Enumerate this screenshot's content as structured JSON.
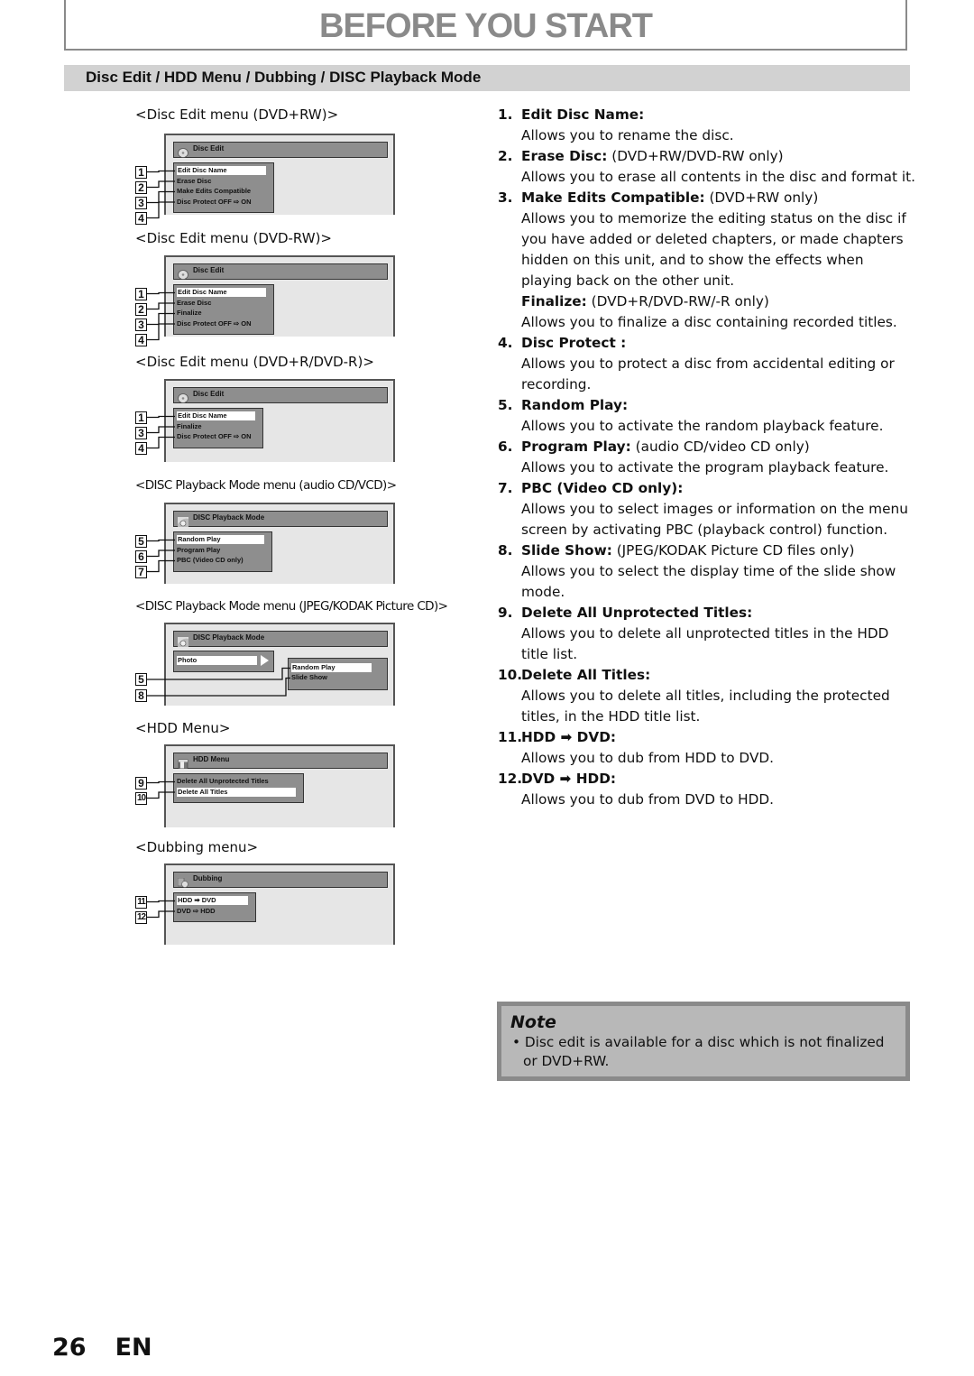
{
  "header": {
    "title": "BEFORE YOU START"
  },
  "section": {
    "title": "Disc Edit / HDD Menu / Dubbing / DISC Playback Mode"
  },
  "menus": [
    {
      "caption": "<Disc Edit menu (DVD+RW)>",
      "screen_title": "Disc Edit",
      "icon": "disc-icon",
      "items": [
        "Edit Disc Name",
        "Erase Disc",
        "Make Edits Compatible",
        "Disc Protect OFF ⇨ ON"
      ],
      "numbers": [
        "1",
        "2",
        "3",
        "4"
      ],
      "selected_index": 0
    },
    {
      "caption": "<Disc Edit menu (DVD-RW)>",
      "screen_title": "Disc Edit",
      "icon": "disc-icon",
      "items": [
        "Edit Disc Name",
        "Erase Disc",
        "Finalize",
        "Disc Protect OFF ⇨ ON"
      ],
      "numbers": [
        "1",
        "2",
        "3",
        "4"
      ],
      "selected_index": 0
    },
    {
      "caption": "<Disc Edit menu (DVD+R/DVD-R)>",
      "screen_title": "Disc Edit",
      "icon": "disc-icon",
      "items": [
        "Edit Disc Name",
        "Finalize",
        "Disc Protect OFF ⇨ ON"
      ],
      "numbers": [
        "1",
        "3",
        "4"
      ],
      "selected_index": 0
    },
    {
      "caption": "<DISC Playback Mode menu (audio CD/VCD)>",
      "screen_title": "DISC Playback Mode",
      "icon": "playback-mode-icon",
      "items": [
        "Random Play",
        "Program Play",
        "PBC (Video CD only)"
      ],
      "numbers": [
        "5",
        "6",
        "7"
      ],
      "selected_index": 0
    },
    {
      "caption": "<DISC Playback Mode menu (JPEG/KODAK Picture CD)>",
      "screen_title": "DISC Playback Mode",
      "icon": "playback-mode-icon",
      "parent_item": "Photo",
      "items": [
        "Random Play",
        "Slide Show"
      ],
      "numbers": [
        "5",
        "8"
      ],
      "selected_index": 0
    },
    {
      "caption": "<HDD Menu>",
      "screen_title": "HDD Menu",
      "icon": "hdd-icon",
      "items": [
        "Delete All Unprotected Titles",
        "Delete All Titles"
      ],
      "numbers": [
        "9",
        "10"
      ],
      "selected_index": 1
    },
    {
      "caption": "<Dubbing menu>",
      "screen_title": "Dubbing",
      "icon": "dubbing-icon",
      "items": [
        "HDD ➡ DVD",
        "DVD ⇨ HDD"
      ],
      "numbers": [
        "11",
        "12"
      ],
      "selected_index": 0
    }
  ],
  "descriptions": [
    {
      "num": "1.",
      "label": "Edit Disc Name:",
      "qualifier": "",
      "text": "Allows you to rename the disc."
    },
    {
      "num": "2.",
      "label": "Erase Disc:",
      "qualifier": " (DVD+RW/DVD-RW only)",
      "text": "Allows you to erase all contents in the disc and format it."
    },
    {
      "num": "3.",
      "label": "Make Edits Compatible:",
      "qualifier": " (DVD+RW only)",
      "text": "Allows you to memorize the editing status on the disc if you have added or deleted chapters, or made chapters hidden on this unit, and to show the effects when playing back on the other unit."
    },
    {
      "num": "",
      "label": "Finalize:",
      "qualifier": " (DVD+R/DVD-RW/-R only)",
      "text": "Allows you to finalize a disc containing recorded titles."
    },
    {
      "num": "4.",
      "label": "Disc Protect :",
      "qualifier": "",
      "text": "Allows you to protect a disc from accidental editing or recording."
    },
    {
      "num": "5.",
      "label": "Random Play:",
      "qualifier": "",
      "text": "Allows you to activate the random playback feature."
    },
    {
      "num": "6.",
      "label": "Program Play:",
      "qualifier": " (audio CD/video CD only)",
      "text": "Allows you to activate the program playback feature."
    },
    {
      "num": "7.",
      "label": "PBC (Video CD only):",
      "qualifier": "",
      "text": "Allows you to select images or information on the menu screen by activating PBC (playback control) function."
    },
    {
      "num": "8.",
      "label": "Slide Show:",
      "qualifier": " (JPEG/KODAK Picture CD files only)",
      "text": "Allows you to select the display time of the slide show mode."
    },
    {
      "num": "9.",
      "label": "Delete All Unprotected Titles:",
      "qualifier": "",
      "text": "Allows you to delete all unprotected titles in the HDD title list."
    },
    {
      "num": "10.",
      "label": "Delete All Titles:",
      "qualifier": "",
      "text": "Allows you to delete all titles, including the protected titles, in the HDD title list."
    },
    {
      "num": "11.",
      "label": "HDD ➡ DVD:",
      "qualifier": "",
      "text": "Allows you to dub from HDD to DVD."
    },
    {
      "num": "12.",
      "label": "DVD ➡ HDD:",
      "qualifier": "",
      "text": "Allows you to dub from DVD to HDD."
    }
  ],
  "note": {
    "title": "Note",
    "bullet": "•",
    "text": "Disc edit is available for a disc which is not finalized or DVD+RW."
  },
  "footer": {
    "page_number": "26",
    "language": "EN"
  }
}
